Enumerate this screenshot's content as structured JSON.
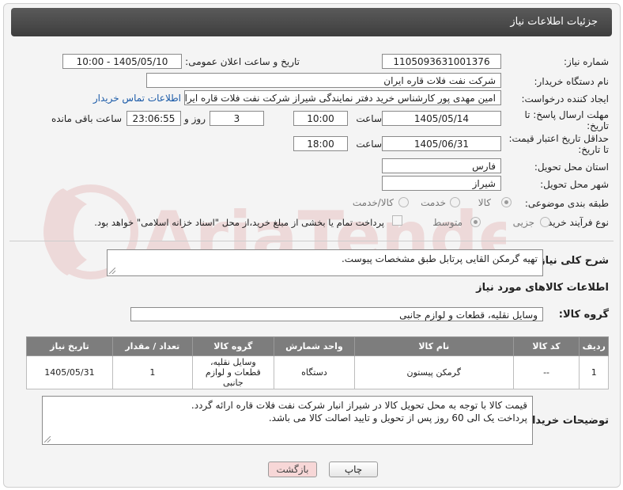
{
  "header": {
    "title": "جزئیات اطلاعات نیاز"
  },
  "form": {
    "need_number_label": "شماره نیاز:",
    "need_number": "1105093631001376",
    "announce_label": "تاریخ و ساعت اعلان عمومی:",
    "announce_value": "1405/05/10 - 10:00",
    "buyer_label": "نام دستگاه خریدار:",
    "buyer_value": "شرکت نفت فلات قاره ایران",
    "requester_label": "ایجاد کننده درخواست:",
    "requester_value": "امین مهدی پور کارشناس خرید دفتر نمایندگی شیراز شرکت نفت فلات قاره ایران",
    "contact_link": "اطلاعات تماس خریدار",
    "deadline_label_1": "مهلت ارسال پاسخ: تا",
    "deadline_label_2": "تاریخ:",
    "deadline_date": "1405/05/14",
    "time_label": "ساعت",
    "deadline_time": "10:00",
    "days_value": "3",
    "days_label": "روز و",
    "remaining_time": "23:06:55",
    "remaining_label": "ساعت باقی مانده",
    "price_label_1": "حداقل تاریخ اعتبار قیمت:",
    "price_label_2": "تا تاریخ:",
    "price_date": "1405/06/31",
    "price_time": "18:00",
    "province_label": "استان محل تحویل:",
    "province_value": "فارس",
    "city_label": "شهر محل تحویل:",
    "city_value": "شیراز",
    "category_label": "طبقه بندی موضوعی:",
    "category_options": [
      "کالا",
      "خدمت",
      "کالا/خدمت"
    ],
    "category_selected": "کالا",
    "process_label": "نوع فرآیند خرید :",
    "process_options": [
      "جزیی",
      "متوسط"
    ],
    "process_selected": "متوسط",
    "payment_note": "پرداخت تمام یا بخشی از مبلغ خرید،از محل \"اسناد خزانه اسلامی\" خواهد بود."
  },
  "description": {
    "label": "شرح کلی نیاز:",
    "value": "تهیه گرمکن القایی پرتابل طبق مشخصات پیوست."
  },
  "goods": {
    "section_title": "اطلاعات کالاهای مورد نیاز",
    "group_label": "گروه کالا:",
    "group_value": "وسایل نقلیه، قطعات و لوازم جانبی",
    "columns": [
      "ردیف",
      "کد کالا",
      "نام کالا",
      "واحد شمارش",
      "گروه کالا",
      "تعداد / مقدار",
      "تاریخ نیاز"
    ],
    "rows": [
      {
        "row": "1",
        "code": "--",
        "name": "گرمکن پیستون",
        "unit": "دستگاه",
        "group": "وسایل نقلیه، قطعات و لوازم جانبی",
        "qty": "1",
        "date": "1405/05/31"
      }
    ]
  },
  "buyer_notes": {
    "label": "توضیحات خریدار:",
    "line1": "قیمت کالا با توجه به محل تحویل کالا در شیراز انبار شرکت نفت فلات قاره ارائه گردد.",
    "line2": "پرداخت  یک الی 60 روز پس از تحویل و تایید اصالت کالا می باشد."
  },
  "buttons": {
    "print": "چاپ",
    "back": "بازگشت"
  },
  "watermark": "AriaTender.net",
  "colors": {
    "titlebar": "#4a4a4a",
    "link": "#1a5aa8",
    "back_button": "#f7d7d7",
    "watermark": "#c03030"
  }
}
